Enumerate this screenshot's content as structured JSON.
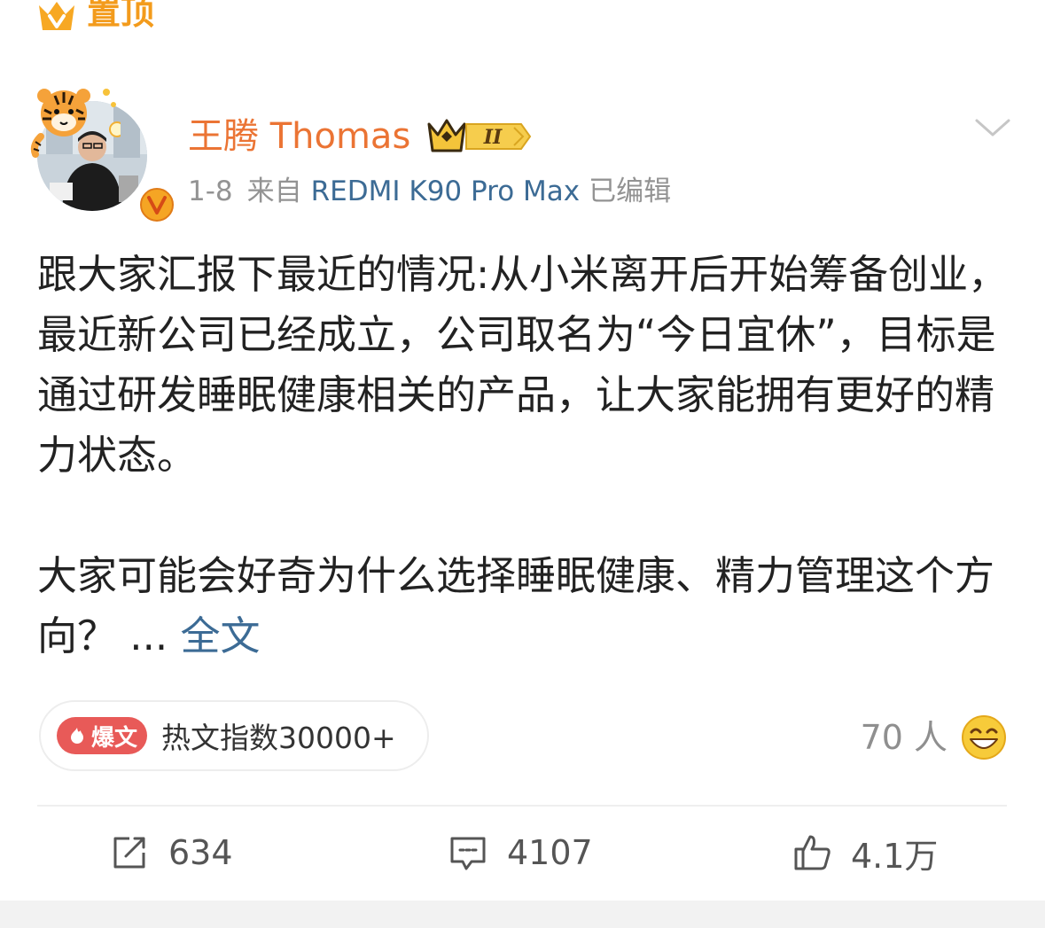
{
  "pinned": {
    "label": "置顶"
  },
  "post": {
    "author": "王腾 Thomas",
    "badge_level": "II",
    "date": "1-8",
    "source_prefix": "来自",
    "device": "REDMI K90 Pro Max",
    "edited": "已编辑",
    "paragraph1": "跟大家汇报下最近的情况:从小米离开后开始筹备创业，最近新公司已经成立，公司取名为“今日宜休”，目标是通过研发睡眠健康相关的产品，让大家能拥有更好的精力状态。",
    "paragraph2": "大家可能会好奇为什么选择睡眠健康、精力管理这个方向？ ... ",
    "full_text_link": "全文"
  },
  "hot": {
    "tag": "爆文",
    "text": "热文指数30000+"
  },
  "reactions": {
    "count_label": "70 人"
  },
  "actions": {
    "repost": "634",
    "comment": "4107",
    "like": "4.1万"
  },
  "colors": {
    "accent_orange": "#eb7434",
    "link_blue": "#3c6b95",
    "hot_red": "#e85a58"
  }
}
